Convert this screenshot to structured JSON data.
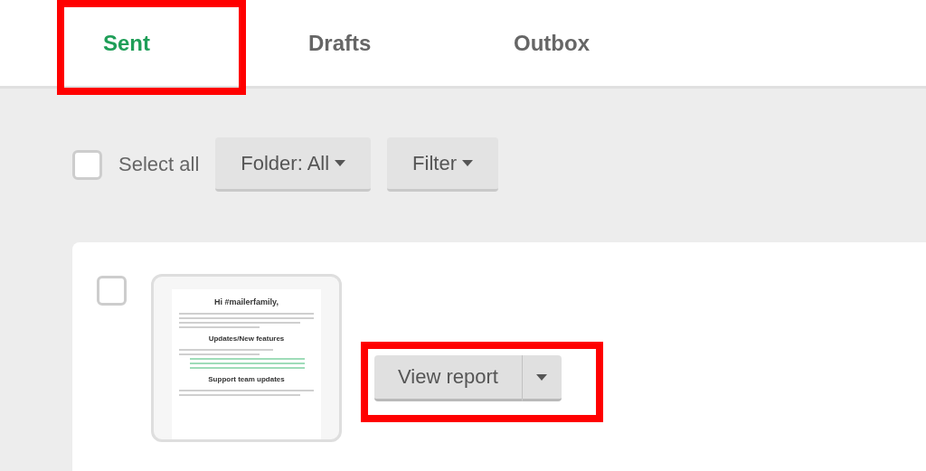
{
  "tabs": [
    {
      "label": "Sent",
      "selected": true,
      "highlighted": true
    },
    {
      "label": "Drafts",
      "selected": false,
      "highlighted": false
    },
    {
      "label": "Outbox",
      "selected": false,
      "highlighted": false
    }
  ],
  "toolbar": {
    "select_all": {
      "label": "Select all",
      "checked": false
    },
    "buttons": [
      {
        "label": "Folder: All"
      },
      {
        "label": "Filter"
      }
    ]
  },
  "campaigns": [
    {
      "checked": false,
      "preview": {
        "headings": [
          "Hi #mailerfamily,",
          "Updates/New features",
          "Support team updates"
        ]
      },
      "action": {
        "label": "View report",
        "highlighted": true
      }
    }
  ]
}
